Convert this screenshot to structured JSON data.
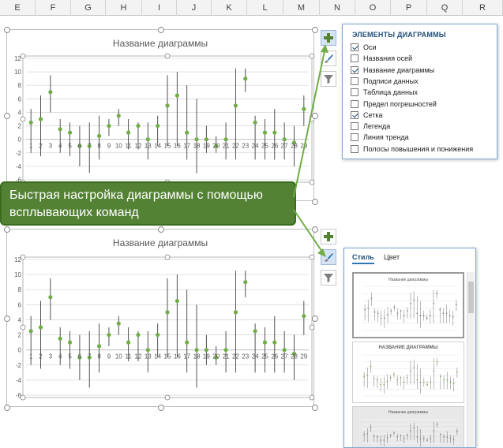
{
  "columns": [
    "E",
    "F",
    "G",
    "H",
    "I",
    "J",
    "K",
    "L",
    "M",
    "N",
    "O",
    "P",
    "Q",
    "R"
  ],
  "charts": {
    "top_title": "Название диаграммы",
    "bottom_title": "Название диаграммы"
  },
  "chart_data": {
    "type": "scatter",
    "title": "Название диаграммы",
    "xlabel": "",
    "ylabel": "",
    "ylim": [
      -6,
      12
    ],
    "yticks": [
      "12",
      "10",
      "8",
      "6",
      "4",
      "2",
      "0",
      "-2",
      "-4",
      "-6"
    ],
    "x": [
      1,
      2,
      3,
      4,
      5,
      6,
      7,
      8,
      9,
      10,
      11,
      12,
      13,
      14,
      15,
      16,
      17,
      18,
      19,
      20,
      21,
      22,
      23,
      24,
      25,
      26,
      27,
      28,
      29
    ],
    "values": [
      2.5,
      3,
      7,
      1.5,
      1,
      -1,
      -1,
      0.5,
      2,
      3.5,
      1,
      2,
      0,
      2,
      5,
      6.5,
      1,
      0,
      0,
      -1,
      0,
      5,
      9,
      2.5,
      1,
      1,
      0,
      -0.5,
      4.5
    ],
    "error_low": [
      -2,
      -2.5,
      4,
      -2,
      -2.5,
      -4,
      -5,
      -3,
      0.5,
      2,
      -1.5,
      -1.5,
      -3,
      -1,
      -1,
      -1,
      -3,
      -5,
      -2,
      -2,
      -3,
      -3,
      7,
      -3,
      -3,
      -3,
      -3,
      -4,
      2
    ],
    "error_high": [
      4.5,
      6.5,
      9.5,
      3,
      2.5,
      2,
      2.5,
      3.5,
      3,
      4.5,
      3,
      2.5,
      2.5,
      3.5,
      9.5,
      10,
      8,
      6,
      2,
      0.5,
      2.5,
      10.5,
      10.5,
      3.5,
      3,
      4.5,
      2.5,
      2,
      6.5
    ],
    "grid": true,
    "color": "#70ad47",
    "error_bar_color": "#404040"
  },
  "elements_panel": {
    "title": "ЭЛЕМЕНТЫ ДИАГРАММЫ",
    "items": [
      {
        "label": "Оси",
        "checked": true
      },
      {
        "label": "Названия осей",
        "checked": false
      },
      {
        "label": "Название диаграммы",
        "checked": true
      },
      {
        "label": "Подписи данных",
        "checked": false
      },
      {
        "label": "Таблица данных",
        "checked": false
      },
      {
        "label": "Предел погрешностей",
        "checked": false
      },
      {
        "label": "Сетка",
        "checked": true
      },
      {
        "label": "Легенда",
        "checked": false
      },
      {
        "label": "Линия тренда",
        "checked": false
      },
      {
        "label": "Полосы повышения и понижения",
        "checked": false
      }
    ]
  },
  "callout": {
    "text": "Быстрая настройка диаграммы с помощью всплывающих команд"
  },
  "style_panel": {
    "tab_style": "Стиль",
    "tab_color": "Цвет",
    "thumb1_title": "Название диаграммы",
    "thumb2_title": "НАЗВАНИЕ ДИАГРАММЫ",
    "thumb3_title": "Название диаграммы"
  },
  "icons": {
    "add": "plus-icon",
    "style": "brush-icon",
    "filter": "funnel-icon"
  },
  "accent_green": "#548235"
}
